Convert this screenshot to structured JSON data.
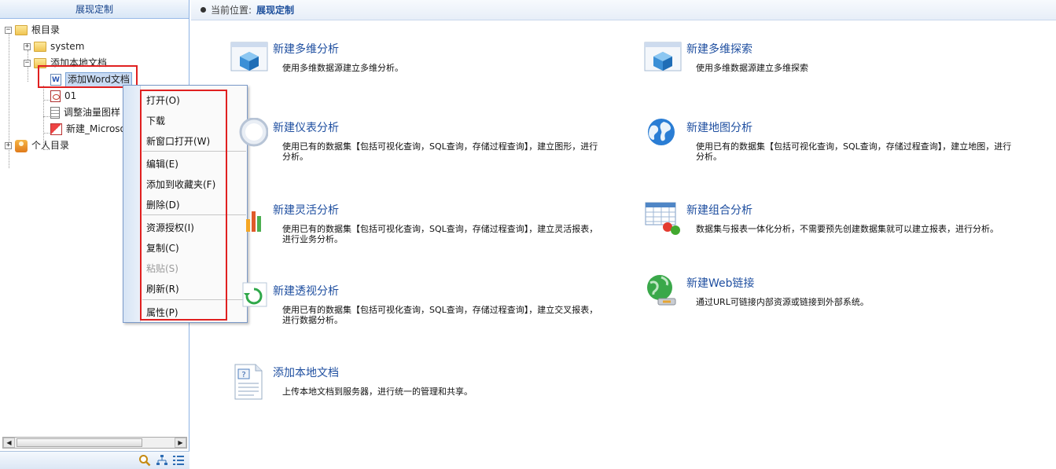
{
  "left_panel": {
    "title": "展现定制",
    "tree": {
      "root": "根目录",
      "system": "system",
      "local_docs": "添加本地文档",
      "word_doc": "添加Word文档",
      "doc_01": "01",
      "doc_oil": "调整油量图样",
      "doc_new": "新建_Microso",
      "personal": "个人目录"
    }
  },
  "context_menu": {
    "items": [
      "打开(O)",
      "下载",
      "新窗口打开(W)",
      "编辑(E)",
      "添加到收藏夹(F)",
      "删除(D)",
      "资源授权(I)",
      "复制(C)",
      "粘贴(S)",
      "刷新(R)",
      "属性(P)"
    ],
    "disabled": [
      "粘贴(S)"
    ]
  },
  "breadcrumb": {
    "label": "当前位置:",
    "current": "展现定制"
  },
  "cards": [
    {
      "title": "新建多维分析",
      "desc": "使用多维数据源建立多维分析。",
      "icon": "cube-window-icon"
    },
    {
      "title": "新建多维探索",
      "desc": "使用多维数据源建立多维探索",
      "icon": "cube-window-icon"
    },
    {
      "title": "新建仪表分析",
      "desc": "使用已有的数据集【包括可视化查询，SQL查询，存储过程查询】，建立图形，进行分析。",
      "icon": "gauge-icon"
    },
    {
      "title": "新建地图分析",
      "desc": "使用已有的数据集【包括可视化查询，SQL查询，存储过程查询】，建立地图，进行分析。",
      "icon": "globe-icon"
    },
    {
      "title": "新建灵活分析",
      "desc": "使用已有的数据集【包括可视化查询，SQL查询，存储过程查询】，建立灵活报表，进行业务分析。",
      "icon": "bar-chart-icon"
    },
    {
      "title": "新建组合分析",
      "desc": "数据集与报表一体化分析，不需要预先创建数据集就可以建立报表，进行分析。",
      "icon": "table-combo-icon"
    },
    {
      "title": "新建透视分析",
      "desc": "使用已有的数据集【包括可视化查询，SQL查询，存储过程查询】，建立交叉报表，进行数据分析。",
      "icon": "pivot-icon"
    },
    {
      "title": "新建Web链接",
      "desc": "通过URL可链接内部资源或链接到外部系统。",
      "icon": "web-link-icon"
    },
    {
      "title": "添加本地文档",
      "desc": "上传本地文档到服务器，进行统一的管理和共享。",
      "icon": "document-help-icon"
    }
  ],
  "colors": {
    "accent": "#1f4fa0",
    "highlight_box": "#e02020"
  }
}
